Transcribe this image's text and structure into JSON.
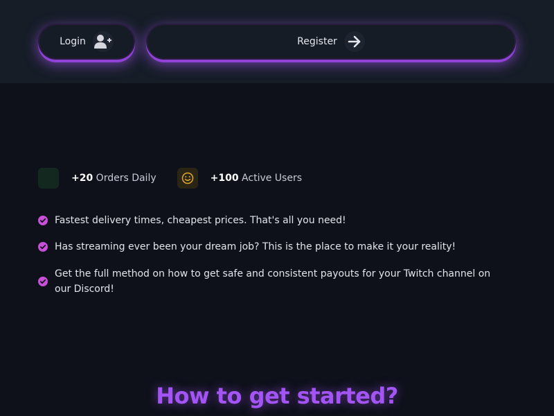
{
  "header": {
    "login_label": "Login",
    "register_label": "Register"
  },
  "stats": [
    {
      "value": "+20",
      "label": "Orders Daily",
      "icon": "cart-icon",
      "color": "#13291f"
    },
    {
      "value": "+100",
      "label": "Active Users",
      "icon": "smiley-icon",
      "color": "#2b2516"
    }
  ],
  "features": [
    "Fastest delivery times, cheapest prices. That's all you need!",
    "Has streaming ever been your dream job? This is the place to make it your reality!",
    "Get the full method on how to get safe and consistent payouts for your Twitch channel on our Discord!"
  ],
  "section_title": "How to get started?",
  "colors": {
    "accent": "#a855f7",
    "background": "#0e111a",
    "header_bg": "#161d27",
    "check": "#c84fd8",
    "smiley": "#e0a82e"
  }
}
